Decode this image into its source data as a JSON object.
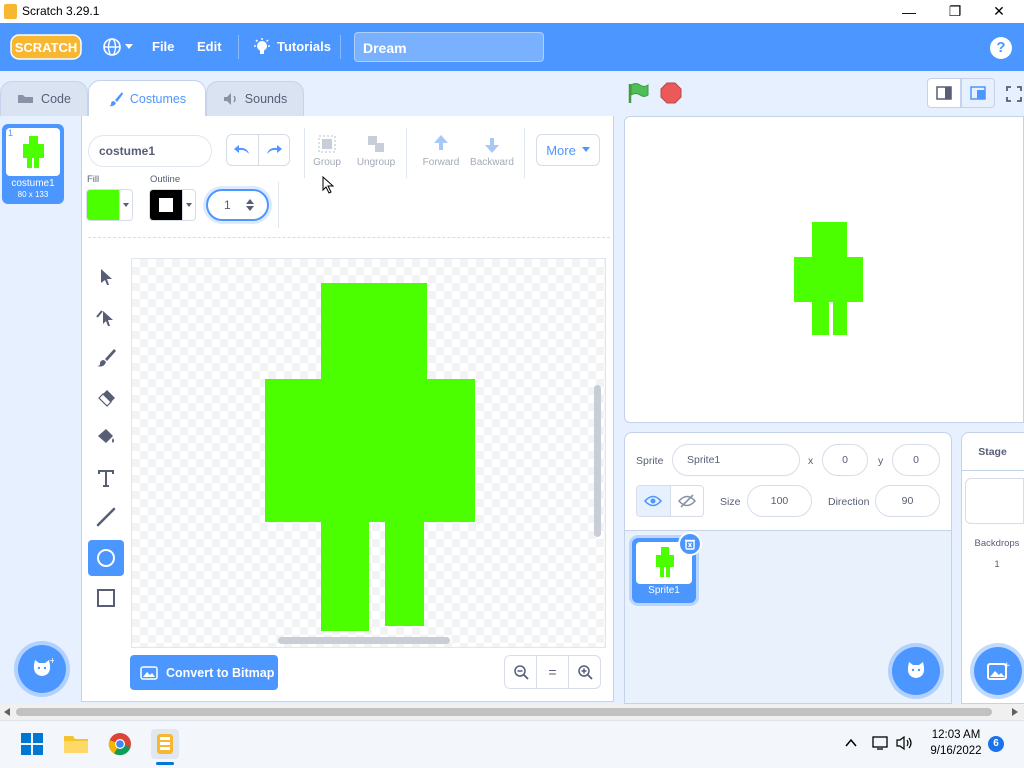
{
  "window": {
    "title": "Scratch 3.29.1",
    "minimize": "—",
    "maximize": "❐",
    "close": "✕"
  },
  "menu": {
    "logo": "SCRATCH",
    "file": "File",
    "edit": "Edit",
    "tutorials": "Tutorials",
    "project_title": "Dream",
    "help": "?"
  },
  "tabs": {
    "code": "Code",
    "costumes": "Costumes",
    "sounds": "Sounds"
  },
  "costume_list": [
    {
      "index": "1",
      "name": "costume1",
      "size": "80 x 133"
    }
  ],
  "paint_editor": {
    "costume_name": "costume1",
    "group": "Group",
    "ungroup": "Ungroup",
    "forward": "Forward",
    "backward": "Backward",
    "more": "More",
    "fill_label": "Fill",
    "outline_label": "Outline",
    "fill_color": "#4cff00",
    "outline_color": "#000000",
    "stroke_width": "1",
    "convert_button": "Convert to Bitmap",
    "zoom_out": "−",
    "zoom_reset": "=",
    "zoom_in": "+",
    "tools": [
      "select-icon",
      "reshape-icon",
      "brush-icon",
      "eraser-icon",
      "fill-icon",
      "text-icon",
      "line-icon",
      "circle-icon",
      "rectangle-icon"
    ],
    "active_tool": "circle-icon"
  },
  "sprite_info": {
    "sprite_label": "Sprite",
    "sprite_name": "Sprite1",
    "x_label": "x",
    "x_value": "0",
    "y_label": "y",
    "y_value": "0",
    "show_label": "Show",
    "size_label": "Size",
    "size_value": "100",
    "direction_label": "Direction",
    "direction_value": "90"
  },
  "sprites": [
    {
      "name": "Sprite1"
    }
  ],
  "stage_pane": {
    "label": "Stage",
    "backdrops_label": "Backdrops",
    "backdrops_count": "1"
  },
  "taskbar": {
    "time": "12:03 AM",
    "date": "9/16/2022",
    "notifications": "6"
  },
  "colors": {
    "accent": "#4c97ff",
    "sprite_green": "#4cff00",
    "green_flag": "#4cbf56",
    "stop": "#ec5959"
  }
}
